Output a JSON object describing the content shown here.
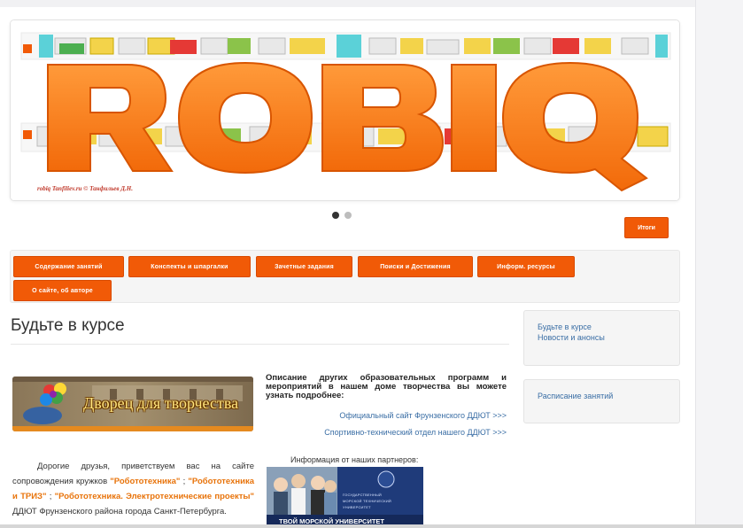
{
  "banner": {
    "logo_text": "ROBIQ",
    "caption": "robiq Tanfiliev.ru © Танфильев Д.Н."
  },
  "carousel": {
    "slides": 2,
    "active": 0
  },
  "buttons": {
    "itogi": "Итоги"
  },
  "nav": {
    "items": [
      {
        "label": "Содержание занятий"
      },
      {
        "label": "Конспекты и шпаргалки"
      },
      {
        "label": "Зачетные задания"
      },
      {
        "label": "Поиски и Достижения"
      },
      {
        "label": "Информ. ресурсы"
      },
      {
        "label": "О сайте, об авторе"
      }
    ]
  },
  "main": {
    "title": "Будьте в курсе",
    "dvorets_text": "Дворец для творчества",
    "greeting": {
      "p1": "Дорогие друзья, приветствуем вас на сайте сопровождения кружков",
      "h1": "\"Робототехника\"",
      "sep1": ";",
      "h2": "\"Робототехника и ТРИЗ\"",
      "sep2": ";",
      "h3": "\"Робототехника. Электротехнические проекты\"",
      "p2": "ДДЮТ Фрунзенского района города Санкт-Петербурга."
    },
    "description": "Описание других образовательных программ и мероприятий в нашем доме творчества вы можете узнать подробнее:",
    "links": {
      "official": "Официальный сайт Фрунзенского ДДЮТ >>>",
      "sport_tech": "Спортивно-технический отдел нашего ДДЮТ >>>"
    },
    "partners_label": "Информация от наших партнеров:",
    "university": {
      "lines": [
        "ГОСУДАРСТВЕННЫЙ",
        "МОРСКОЙ ТЕХНИЧЕСКИЙ",
        "УНИВЕРСИТЕТ"
      ],
      "slogan": "ТВОЙ МОРСКОЙ УНИВЕРСИТЕТ"
    }
  },
  "sidebar": {
    "news_title": "Будьте в курсе",
    "news_subtitle": "Новости и анонсы",
    "schedule": "Расписание занятий"
  },
  "colors": {
    "accent": "#f15a07",
    "link": "#3a6ea5",
    "highlight": "#e8730a"
  }
}
